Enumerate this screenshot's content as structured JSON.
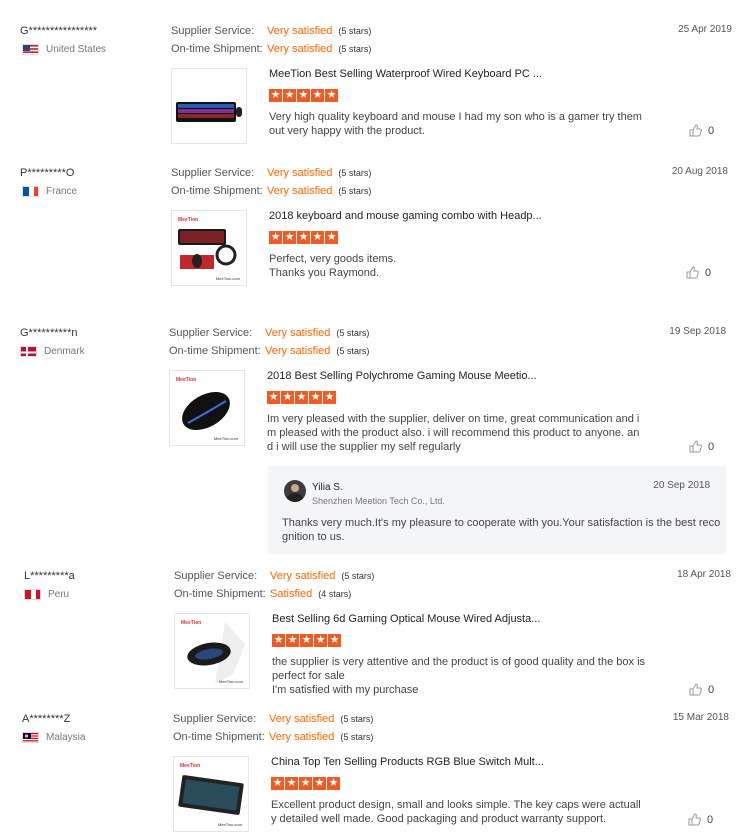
{
  "labels": {
    "supplier_service": "Supplier Service:",
    "on_time": "On-time Shipment:"
  },
  "reviews": [
    {
      "buyer": "G****************",
      "country": "United States",
      "flag": "us",
      "service": "Very satisfied",
      "service_stars": "(5 stars)",
      "shipment": "Very satisfied",
      "shipment_stars": "(5 stars)",
      "date": "25 Apr 2019",
      "product": "MeeTion Best Selling Waterproof Wired Keyboard PC ...",
      "rating": 5,
      "text": "Very high quality keyboard and mouse I had my son who is a gamer try them out very happy with the product.",
      "likes": "0"
    },
    {
      "buyer": "P*********O",
      "country": "France",
      "flag": "fr",
      "service": "Very satisfied",
      "service_stars": "(5 stars)",
      "shipment": "Very satisfied",
      "shipment_stars": "(5 stars)",
      "date": "20 Aug 2018",
      "product": "2018 keyboard and mouse gaming combo with Headp...",
      "rating": 5,
      "text": "Perfect, very goods items.\nThanks you Raymond.",
      "likes": "0"
    },
    {
      "buyer": "G**********n",
      "country": "Denmark",
      "flag": "dk",
      "service": "Very satisfied",
      "service_stars": "(5 stars)",
      "shipment": "Very satisfied",
      "shipment_stars": "(5 stars)",
      "date": "19 Sep 2018",
      "product": "2018 Best Selling Polychrome Gaming Mouse Meetio...",
      "rating": 5,
      "text": "Im very pleased with the supplier, deliver on time, great communication and im pleased with the product also. i will recommend this product to anyone. and i will use the supplier my self regularly",
      "likes": "0"
    },
    {
      "buyer": "L*********a",
      "country": "Peru",
      "flag": "pe",
      "service": "Very satisfied",
      "service_stars": "(5 stars)",
      "shipment": "Satisfied",
      "shipment_stars": "(4 stars)",
      "date": "18 Apr 2018",
      "product": "Best Selling 6d Gaming Optical Mouse Wired Adjusta...",
      "rating": 5,
      "text": "the supplier is very attentive and the product is of good quality and the box is perfect for sale\nI'm satisfied with my purchase",
      "likes": "0"
    },
    {
      "buyer": "A********Z",
      "country": "Malaysia",
      "flag": "my",
      "service": "Very satisfied",
      "service_stars": "(5 stars)",
      "shipment": "Very satisfied",
      "shipment_stars": "(5 stars)",
      "date": "15 Mar 2018",
      "product": "China Top Ten Selling Products RGB Blue Switch Mult...",
      "rating": 5,
      "text": "Excellent product design, small and looks simple. The key caps were actually detailed well made. Good packaging and product warranty support.",
      "likes": "0"
    }
  ],
  "reply": {
    "name": "Yilia S.",
    "company": "Shenzhen Meetion Tech Co., Ltd.",
    "date": "20 Sep 2018",
    "text": "Thanks very much.It's my pleasure to cooperate with you.Your satisfaction is the best recognition to us."
  },
  "thumb_logo": "MeeTion",
  "thumb_brand": "MeeTion.com",
  "colors": {
    "accent": "#ff6600",
    "star": "#f15a22"
  }
}
